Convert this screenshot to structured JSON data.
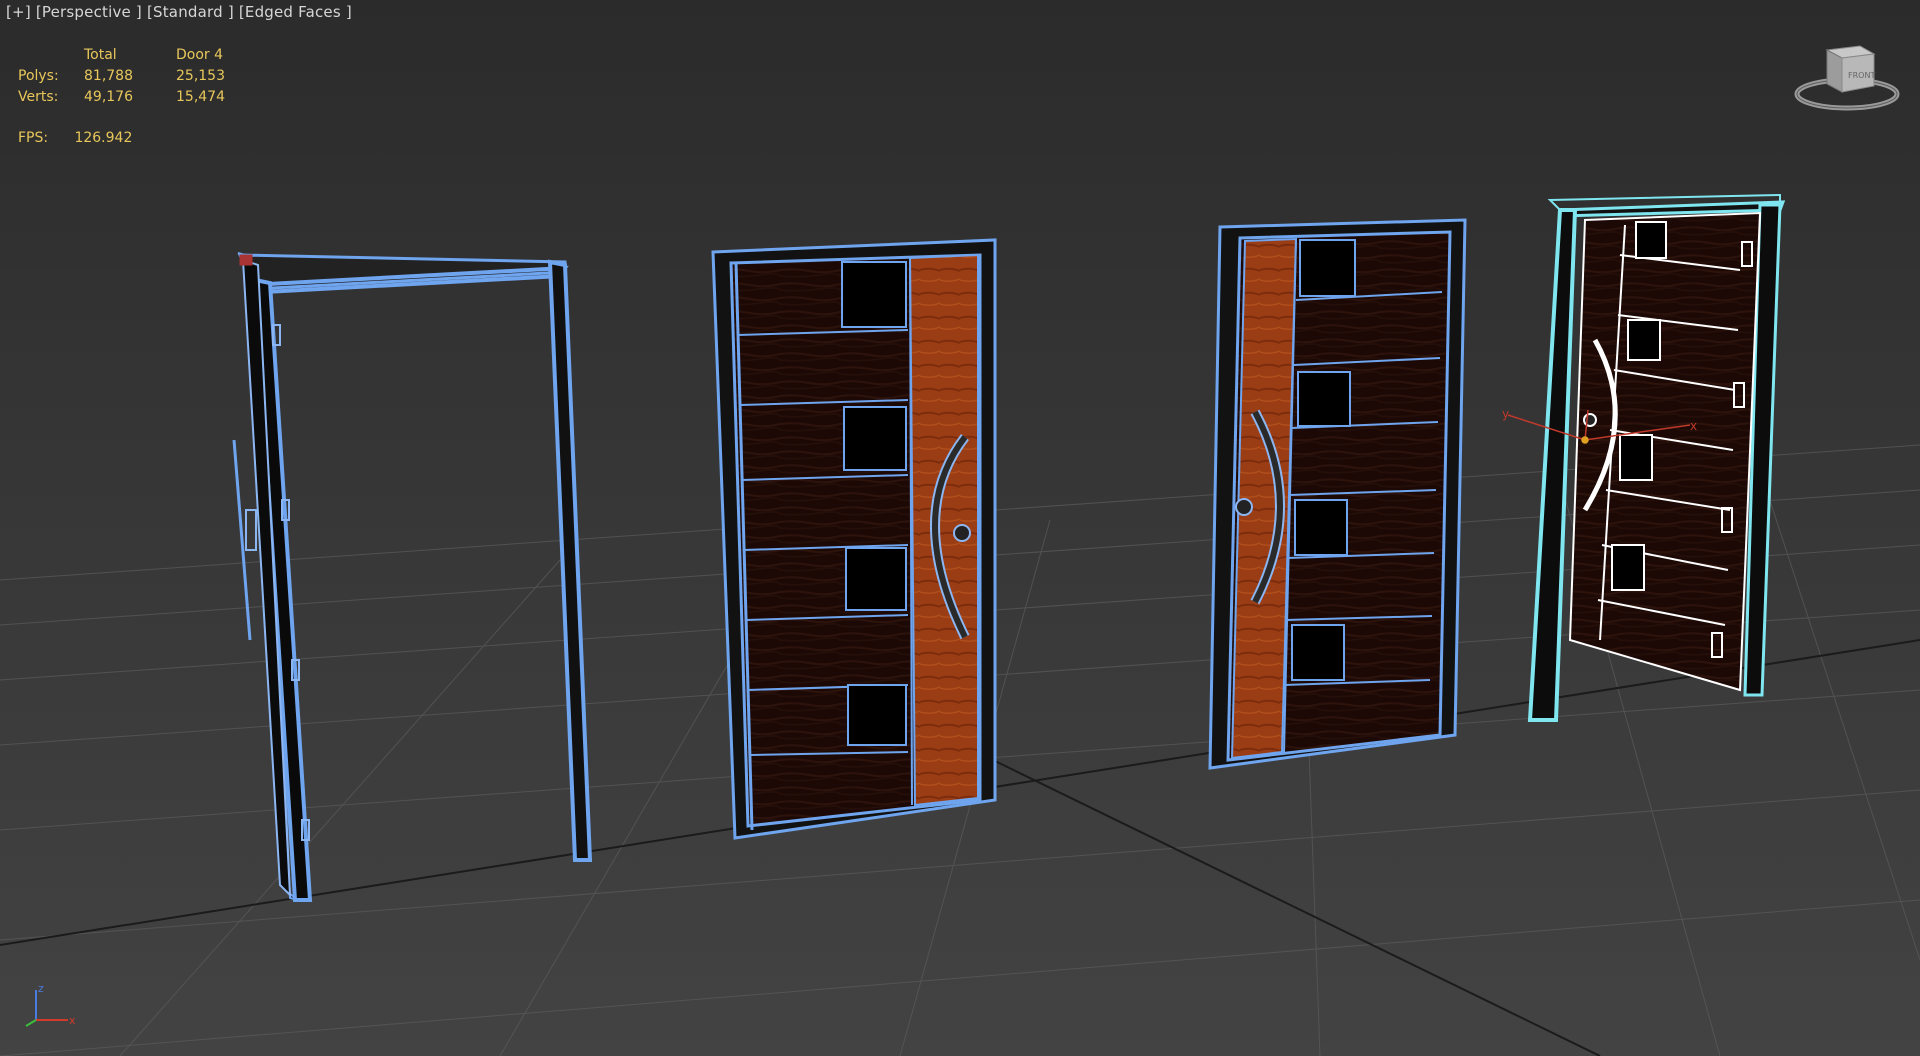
{
  "viewport": {
    "label": "[+] [Perspective ] [Standard ] [Edged Faces ]",
    "background": "#3a3a3a"
  },
  "stats": {
    "header_total": "Total",
    "header_selected": "Door 4",
    "polys_label": "Polys:",
    "polys_total": "81,788",
    "polys_selected": "25,153",
    "verts_label": "Verts:",
    "verts_total": "49,176",
    "verts_selected": "15,474",
    "fps_label": "FPS:",
    "fps_value": "126.942",
    "color": "#e8c75a"
  },
  "viewcube": {
    "face_label": "FRONT",
    "icon": "viewcube-icon"
  },
  "gizmo": {
    "x_label": "x",
    "y_label": "y"
  },
  "axis_tripod": {
    "x_label": "x",
    "z_label": "z"
  },
  "colors": {
    "wire_blue": "#6fa4ee",
    "wire_selected": "#7fe6f0",
    "dark_wood": "#1e0b07",
    "orange_wood": "#9a3a12",
    "grid": "#555555"
  }
}
